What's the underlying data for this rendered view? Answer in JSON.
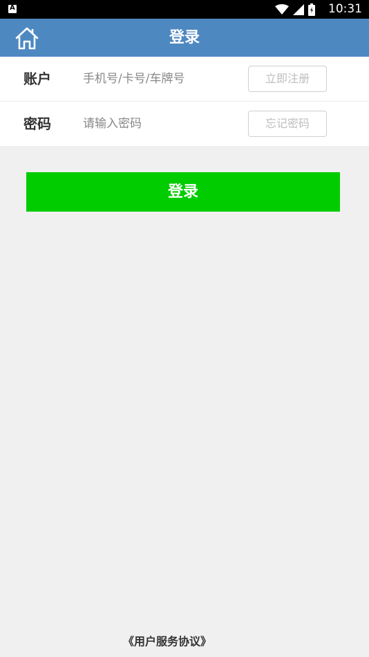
{
  "status_bar": {
    "notification_icon": "text-a-icon",
    "time": "10:31",
    "icons": [
      "wifi-icon",
      "signal-icon",
      "battery-icon"
    ]
  },
  "header": {
    "title": "登录",
    "home_icon": "home-icon",
    "background_color": "#4d88c1"
  },
  "form": {
    "account": {
      "label": "账户",
      "placeholder": "手机号/卡号/车牌号",
      "value": "",
      "action_label": "立即注册"
    },
    "password": {
      "label": "密码",
      "placeholder": "请输入密码",
      "value": "",
      "action_label": "忘记密码"
    }
  },
  "login_button": {
    "label": "登录",
    "color": "#00cc00"
  },
  "footer": {
    "agreement_link": "《用户服务协议》"
  }
}
